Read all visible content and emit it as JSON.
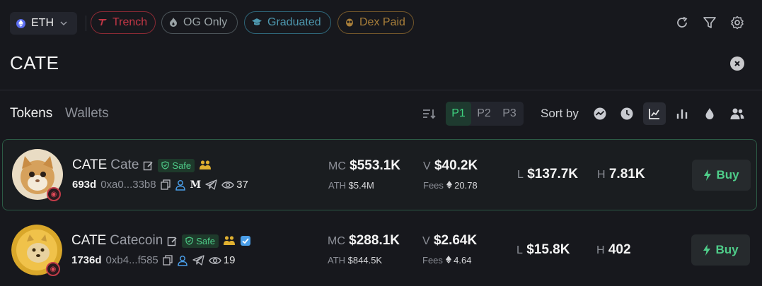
{
  "topbar": {
    "chain_label": "ETH",
    "filters": [
      {
        "label": "Trench",
        "icon": "trench-icon"
      },
      {
        "label": "OG Only",
        "icon": "flame-icon"
      },
      {
        "label": "Graduated",
        "icon": "graduation-cap-icon"
      },
      {
        "label": "Dex Paid",
        "icon": "owl-icon"
      }
    ],
    "icons": [
      "refresh-icon",
      "filter-icon",
      "settings-icon"
    ]
  },
  "search": {
    "value": "CATE"
  },
  "tabs": {
    "tokens": "Tokens",
    "wallets": "Wallets"
  },
  "pages": [
    "P1",
    "P2",
    "P3"
  ],
  "active_page": "P1",
  "sort": {
    "label": "Sort by",
    "icons": [
      "trend-icon",
      "clock-icon",
      "chart-line-icon",
      "bar-chart-icon",
      "droplet-icon",
      "users-icon"
    ],
    "active": "chart-line-icon"
  },
  "rows": [
    {
      "ticker": "CATE",
      "name": "Cate",
      "safe_label": "Safe",
      "age": "693d",
      "address": "0xa0...33b8",
      "medium_label": "M",
      "views": "37",
      "mc_label": "MC",
      "mc_value": "$553.1K",
      "ath_label": "ATH",
      "ath_value": "$5.4M",
      "vol_label": "V",
      "vol_value": "$40.2K",
      "fees_label": "Fees",
      "fees_value": "20.78",
      "liq_label": "L",
      "liq_value": "$137.7K",
      "holders_label": "H",
      "holders_value": "7.81K",
      "buy_label": "Buy"
    },
    {
      "ticker": "CATE",
      "name": "Catecoin",
      "safe_label": "Safe",
      "age": "1736d",
      "address": "0xb4...f585",
      "views": "19",
      "mc_label": "MC",
      "mc_value": "$288.1K",
      "ath_label": "ATH",
      "ath_value": "$844.5K",
      "vol_label": "V",
      "vol_value": "$2.64K",
      "fees_label": "Fees",
      "fees_value": "4.64",
      "liq_label": "L",
      "liq_value": "$15.8K",
      "holders_label": "H",
      "holders_value": "402",
      "buy_label": "Buy"
    }
  ],
  "colors": {
    "accent_green": "#3fd480",
    "trench_red": "#c43746",
    "graduated_teal": "#4d97ae",
    "dexpaid_gold": "#a97f3a"
  }
}
